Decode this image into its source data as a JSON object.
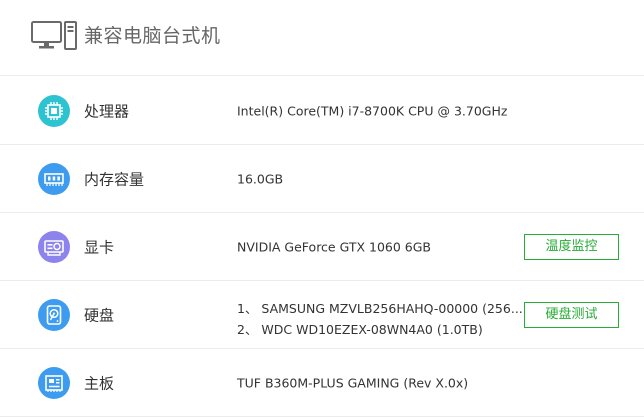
{
  "header": {
    "title": "兼容电脑台式机",
    "icon": "desktop-computer-icon"
  },
  "rows": [
    {
      "label": "处理器",
      "icon": "cpu-chip-icon",
      "color": "#2ec3d1",
      "value": "Intel(R) Core(TM) i7-8700K CPU @ 3.70GHz"
    },
    {
      "label": "内存容量",
      "icon": "memory-icon",
      "color": "#3d9cf0",
      "value": "16.0GB"
    },
    {
      "label": "显卡",
      "icon": "graphics-card-icon",
      "color": "#8c84ec",
      "value": "NVIDIA GeForce GTX 1060 6GB",
      "button": "温度监控"
    },
    {
      "label": "硬盘",
      "icon": "hard-disk-icon",
      "color": "#3d9cf0",
      "values": [
        "1、  SAMSUNG MZVLB256HAHQ-00000 (256...",
        "2、  WDC WD10EZEX-08WN4A0 (1.0TB)"
      ],
      "button": "硬盘测试"
    },
    {
      "label": "主板",
      "icon": "motherboard-icon",
      "color": "#3d9cf0",
      "value": "TUF B360M-PLUS GAMING (Rev X.0x)"
    }
  ],
  "accent": "#26ad35"
}
